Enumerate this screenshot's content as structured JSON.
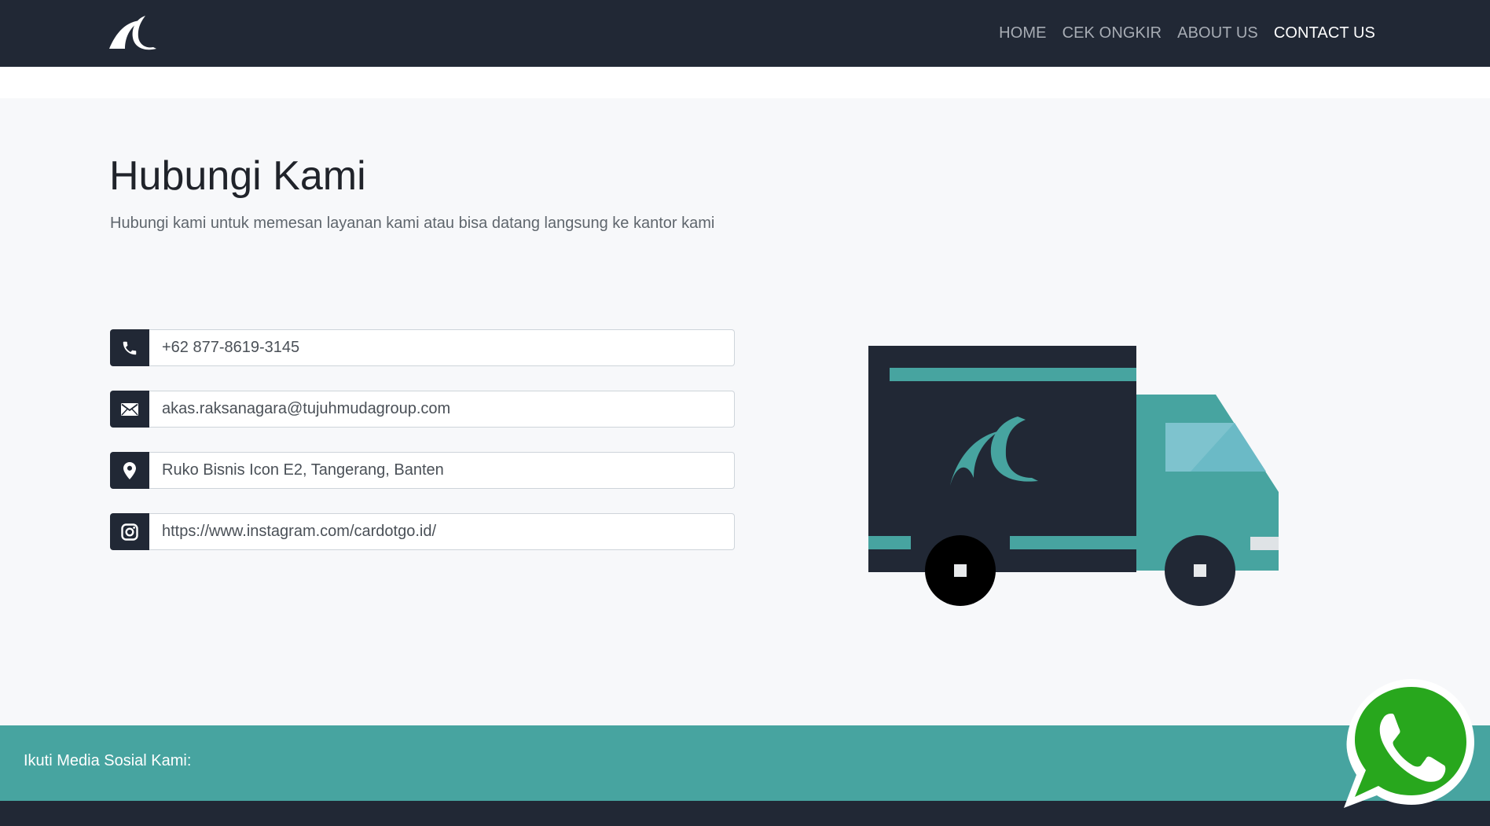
{
  "colors": {
    "navbar": "#212835",
    "accent": "#47a4a0",
    "page_background": "#f7f8fa",
    "whatsapp_green": "#28a71d"
  },
  "navbar": {
    "logo_icon": "wave-logo",
    "links": [
      {
        "label": "HOME",
        "active": false
      },
      {
        "label": "CEK ONGKIR",
        "active": false
      },
      {
        "label": "ABOUT US",
        "active": false
      },
      {
        "label": "CONTACT US",
        "active": true
      }
    ]
  },
  "main": {
    "title": "Hubungi Kami",
    "subtitle": "Hubungi kami untuk memesan layanan kami atau bisa datang langsung ke kantor kami",
    "contacts": [
      {
        "icon": "phone-icon",
        "value": "+62 877-8619-3145"
      },
      {
        "icon": "mail-icon",
        "value": "akas.raksanagara@tujuhmudagroup.com"
      },
      {
        "icon": "map-pin-icon",
        "value": "Ruko Bisnis Icon E2, Tangerang, Banten"
      },
      {
        "icon": "instagram-icon",
        "value": "https://www.instagram.com/cardotgo.id/"
      }
    ],
    "illustration": "delivery-truck"
  },
  "footer": {
    "social_label": "Ikuti Media Sosial Kami:",
    "floating_button_icon": "whatsapp-icon"
  }
}
